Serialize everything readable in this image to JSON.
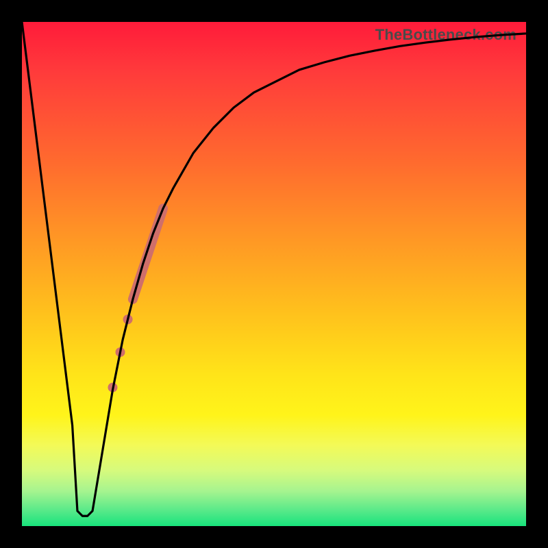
{
  "watermark": "TheBottleneck.com",
  "chart_data": {
    "type": "line",
    "title": "",
    "xlabel": "",
    "ylabel": "",
    "xlim": [
      0,
      100
    ],
    "ylim": [
      0,
      100
    ],
    "grid": false,
    "series": [
      {
        "name": "bottleneck-curve",
        "color": "#000000",
        "x": [
          0,
          2,
          4,
          6,
          8,
          10,
          11,
          12,
          13,
          14,
          16,
          18,
          20,
          22,
          24,
          26,
          28,
          30,
          34,
          38,
          42,
          46,
          50,
          55,
          60,
          65,
          70,
          75,
          80,
          85,
          90,
          95,
          100
        ],
        "y": [
          100,
          84,
          68,
          52,
          36,
          20,
          3,
          2,
          2,
          3,
          15,
          27,
          37,
          45,
          52,
          58,
          63,
          67,
          74,
          79,
          83,
          86,
          88,
          90.5,
          92,
          93.3,
          94.3,
          95.2,
          95.9,
          96.5,
          97,
          97.4,
          97.7
        ]
      }
    ],
    "markers": {
      "name": "range-markers",
      "color": "#cf6f6a",
      "segment": {
        "x": [
          22,
          28
        ],
        "y": [
          45,
          63
        ],
        "width": 14
      },
      "dots": [
        {
          "x": 21.0,
          "y": 41.0,
          "r": 7
        },
        {
          "x": 19.5,
          "y": 34.5,
          "r": 7
        },
        {
          "x": 18.0,
          "y": 27.5,
          "r": 7
        }
      ]
    },
    "background_gradient": {
      "top": "#ff1b3a",
      "bottom": "#18e37c"
    }
  }
}
